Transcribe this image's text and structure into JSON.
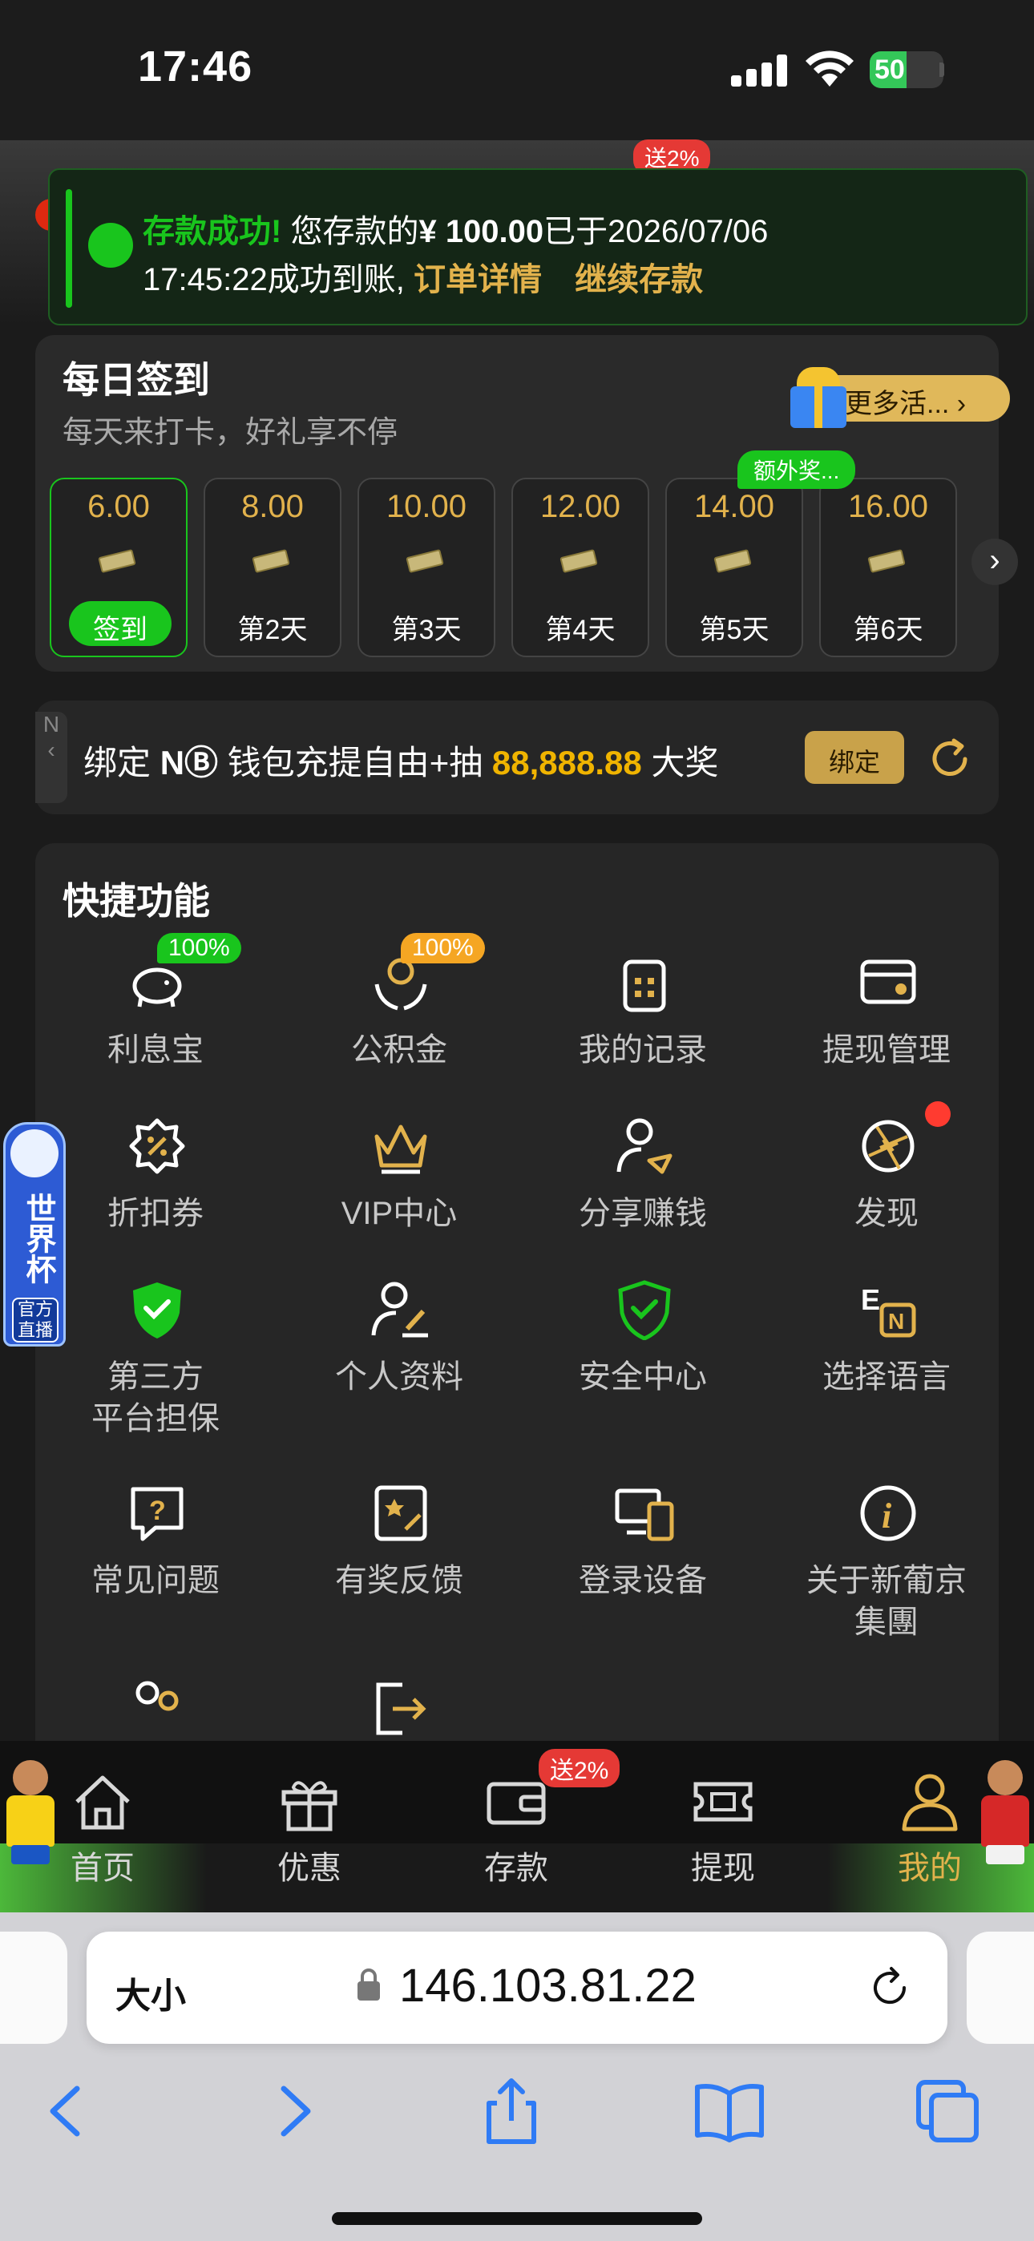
{
  "status_bar": {
    "time": "17:46",
    "battery": "50",
    "battery_level": 0.5
  },
  "background": {
    "bonus_badge": "送2%",
    "withdraw_label": "提现"
  },
  "toast": {
    "title": "存款成功!",
    "message_a": "您存款的",
    "amount": "¥ 100.00",
    "message_b": "已于2026/07/06",
    "message_c": "17:45:22成功到账,",
    "link_order": "订单详情",
    "link_continue": "继续存款"
  },
  "checkin": {
    "title": "每日签到",
    "subtitle": "每天来打卡，好礼享不停",
    "more_button": "更多活...",
    "extra_badge": "额外奖...",
    "days": [
      {
        "amount": "6.00",
        "label": "签到"
      },
      {
        "amount": "8.00",
        "label": "第2天"
      },
      {
        "amount": "10.00",
        "label": "第3天"
      },
      {
        "amount": "12.00",
        "label": "第4天"
      },
      {
        "amount": "14.00",
        "label": "第5天"
      },
      {
        "amount": "16.00",
        "label": "第6天"
      }
    ]
  },
  "bind": {
    "tab_letter": "N",
    "text_pre": "绑定",
    "brand": "NⒷ",
    "text_mid": "钱包充提自由+抽",
    "prize": "88,888.88",
    "text_post": "大奖",
    "button": "绑定"
  },
  "quick": {
    "title": "快捷功能",
    "items": [
      {
        "label": "利息宝",
        "badge": "100%"
      },
      {
        "label": "公积金",
        "badge": "100%"
      },
      {
        "label": "我的记录"
      },
      {
        "label": "提现管理"
      },
      {
        "label": "折扣券"
      },
      {
        "label": "VIP中心"
      },
      {
        "label": "分享赚钱"
      },
      {
        "label": "发现"
      },
      {
        "label": "第三方\n平台担保"
      },
      {
        "label": "个人资料"
      },
      {
        "label": "安全中心"
      },
      {
        "label": "选择语言"
      },
      {
        "label": "常见问题"
      },
      {
        "label": "有奖反馈"
      },
      {
        "label": "登录设备"
      },
      {
        "label": "关于新葡京\n集團"
      }
    ]
  },
  "worldcup": {
    "text": "世界杯",
    "live": "官方直播"
  },
  "nav": {
    "bonus_badge": "送2%",
    "items": [
      {
        "label": "首页"
      },
      {
        "label": "优惠"
      },
      {
        "label": "存款"
      },
      {
        "label": "提现"
      },
      {
        "label": "我的"
      }
    ]
  },
  "safari": {
    "text_size": "大小",
    "url": "146.103.81.22"
  },
  "colors": {
    "accent_gold": "#e2b24c",
    "success_green": "#19c51d",
    "badge_red": "#e53935"
  }
}
